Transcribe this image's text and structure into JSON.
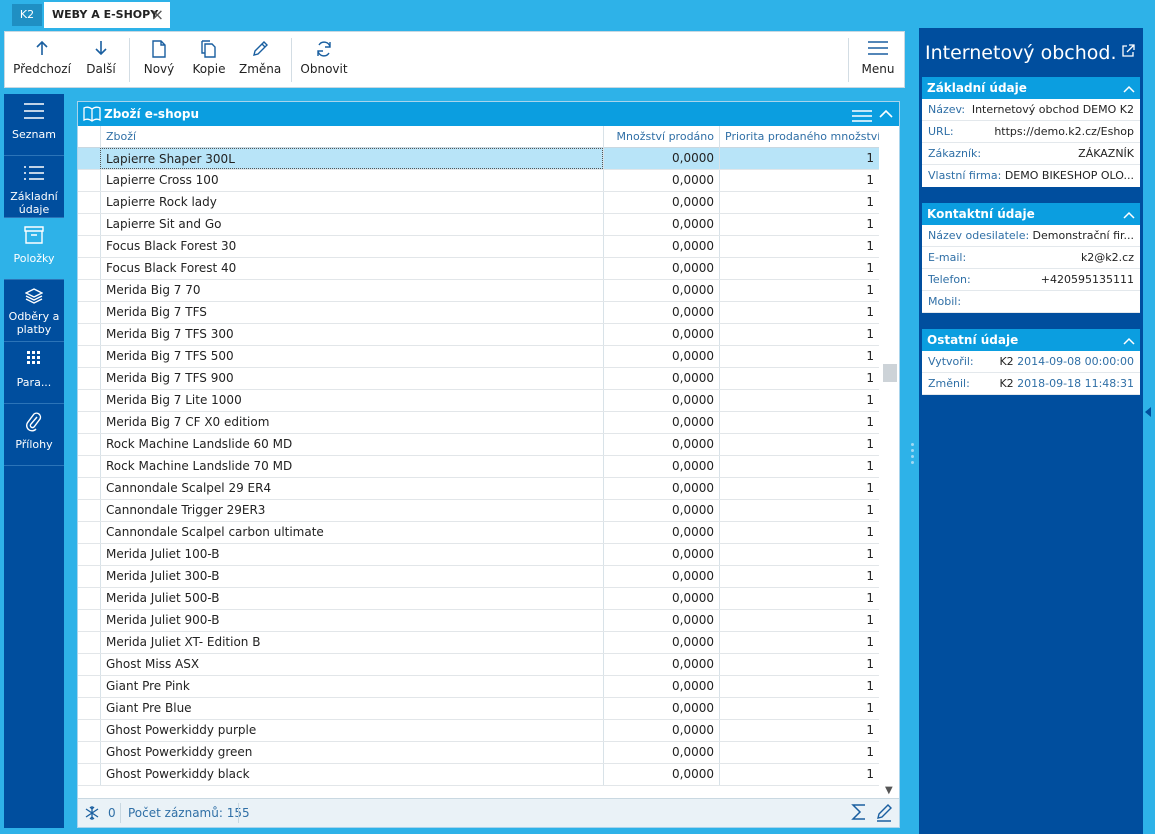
{
  "tabs": {
    "k2": "K2",
    "active": "WEBY A E-SHOPY"
  },
  "toolbar": {
    "prev": "Předchozí",
    "next": "Další",
    "new": "Nový",
    "copy": "Kopie",
    "change": "Změna",
    "refresh": "Obnovit",
    "menu": "Menu"
  },
  "leftnav": {
    "items": [
      {
        "label": "Seznam",
        "icon": "list-lines-icon"
      },
      {
        "label": "Základní údaje",
        "icon": "bullet-list-icon"
      },
      {
        "label": "Položky",
        "icon": "box-icon"
      },
      {
        "label": "Odběry a platby",
        "icon": "layers-icon"
      },
      {
        "label": "Para...",
        "icon": "grid-icon"
      },
      {
        "label": "Přílohy",
        "icon": "paperclip-icon"
      }
    ]
  },
  "grid": {
    "title": "Zboží e-shopu",
    "columns": [
      "Zboží",
      "Množství prodáno",
      "Priorita prodaného množství"
    ],
    "rows": [
      [
        "Lapierre Shaper 300L",
        "0,0000",
        "1"
      ],
      [
        "Lapierre Cross 100",
        "0,0000",
        "1"
      ],
      [
        "Lapierre Rock lady",
        "0,0000",
        "1"
      ],
      [
        "Lapierre Sit and Go",
        "0,0000",
        "1"
      ],
      [
        "Focus Black Forest 30",
        "0,0000",
        "1"
      ],
      [
        "Focus Black Forest 40",
        "0,0000",
        "1"
      ],
      [
        "Merida Big 7 70",
        "0,0000",
        "1"
      ],
      [
        "Merida Big 7 TFS",
        "0,0000",
        "1"
      ],
      [
        "Merida Big 7 TFS 300",
        "0,0000",
        "1"
      ],
      [
        "Merida Big 7 TFS 500",
        "0,0000",
        "1"
      ],
      [
        "Merida Big 7 TFS 900",
        "0,0000",
        "1"
      ],
      [
        "Merida Big 7 Lite 1000",
        "0,0000",
        "1"
      ],
      [
        "Merida Big 7 CF X0 editiom",
        "0,0000",
        "1"
      ],
      [
        "Rock Machine Landslide 60 MD",
        "0,0000",
        "1"
      ],
      [
        "Rock Machine Landslide 70 MD",
        "0,0000",
        "1"
      ],
      [
        "Cannondale Scalpel 29 ER4",
        "0,0000",
        "1"
      ],
      [
        "Cannondale Trigger 29ER3",
        "0,0000",
        "1"
      ],
      [
        "Cannondale Scalpel carbon ultimate",
        "0,0000",
        "1"
      ],
      [
        "Merida Juliet 100-B",
        "0,0000",
        "1"
      ],
      [
        "Merida Juliet 300-B",
        "0,0000",
        "1"
      ],
      [
        "Merida Juliet 500-B",
        "0,0000",
        "1"
      ],
      [
        "Merida Juliet 900-B",
        "0,0000",
        "1"
      ],
      [
        "Merida Juliet XT- Edition B",
        "0,0000",
        "1"
      ],
      [
        "Ghost Miss ASX",
        "0,0000",
        "1"
      ],
      [
        "Giant Pre Pink",
        "0,0000",
        "1"
      ],
      [
        "Giant Pre Blue",
        "0,0000",
        "1"
      ],
      [
        "Ghost Powerkiddy purple",
        "0,0000",
        "1"
      ],
      [
        "Ghost Powerkiddy green",
        "0,0000",
        "1"
      ],
      [
        "Ghost Powerkiddy black",
        "0,0000",
        "1"
      ]
    ],
    "selected_row": 0,
    "status": {
      "filter_count": "0",
      "record_count": "Počet záznamů: 155"
    }
  },
  "detail": {
    "title": "Internetový obchod...",
    "sections": [
      {
        "title": "Základní údaje",
        "fields": [
          {
            "k": "Název:",
            "v": "Internetový obchod DEMO K2"
          },
          {
            "k": "URL:",
            "v": "https://demo.k2.cz/Eshop"
          },
          {
            "k": "Zákazník:",
            "v": "ZÁKAZNÍK"
          },
          {
            "k": "Vlastní firma:",
            "v": "DEMO BIKESHOP OLO..."
          }
        ]
      },
      {
        "title": "Kontaktní údaje",
        "fields": [
          {
            "k": "Název odesilatele:",
            "v": "Demonstrační fir..."
          },
          {
            "k": "E-mail:",
            "v": "k2@k2.cz"
          },
          {
            "k": "Telefon:",
            "v": "+420595135111"
          },
          {
            "k": "Mobil:",
            "v": ""
          }
        ]
      },
      {
        "title": "Ostatní údaje",
        "fields": [
          {
            "k": "Vytvořil:",
            "user": "K2",
            "v": "2014-09-08 00:00:00"
          },
          {
            "k": "Změnil:",
            "user": "K2",
            "v": "2018-09-18 11:48:31"
          }
        ]
      }
    ]
  },
  "colors": {
    "accent": "#2eb2e8",
    "header": "#0b9ee0",
    "nav": "#004e9e",
    "selection": "#b8e4f8"
  }
}
